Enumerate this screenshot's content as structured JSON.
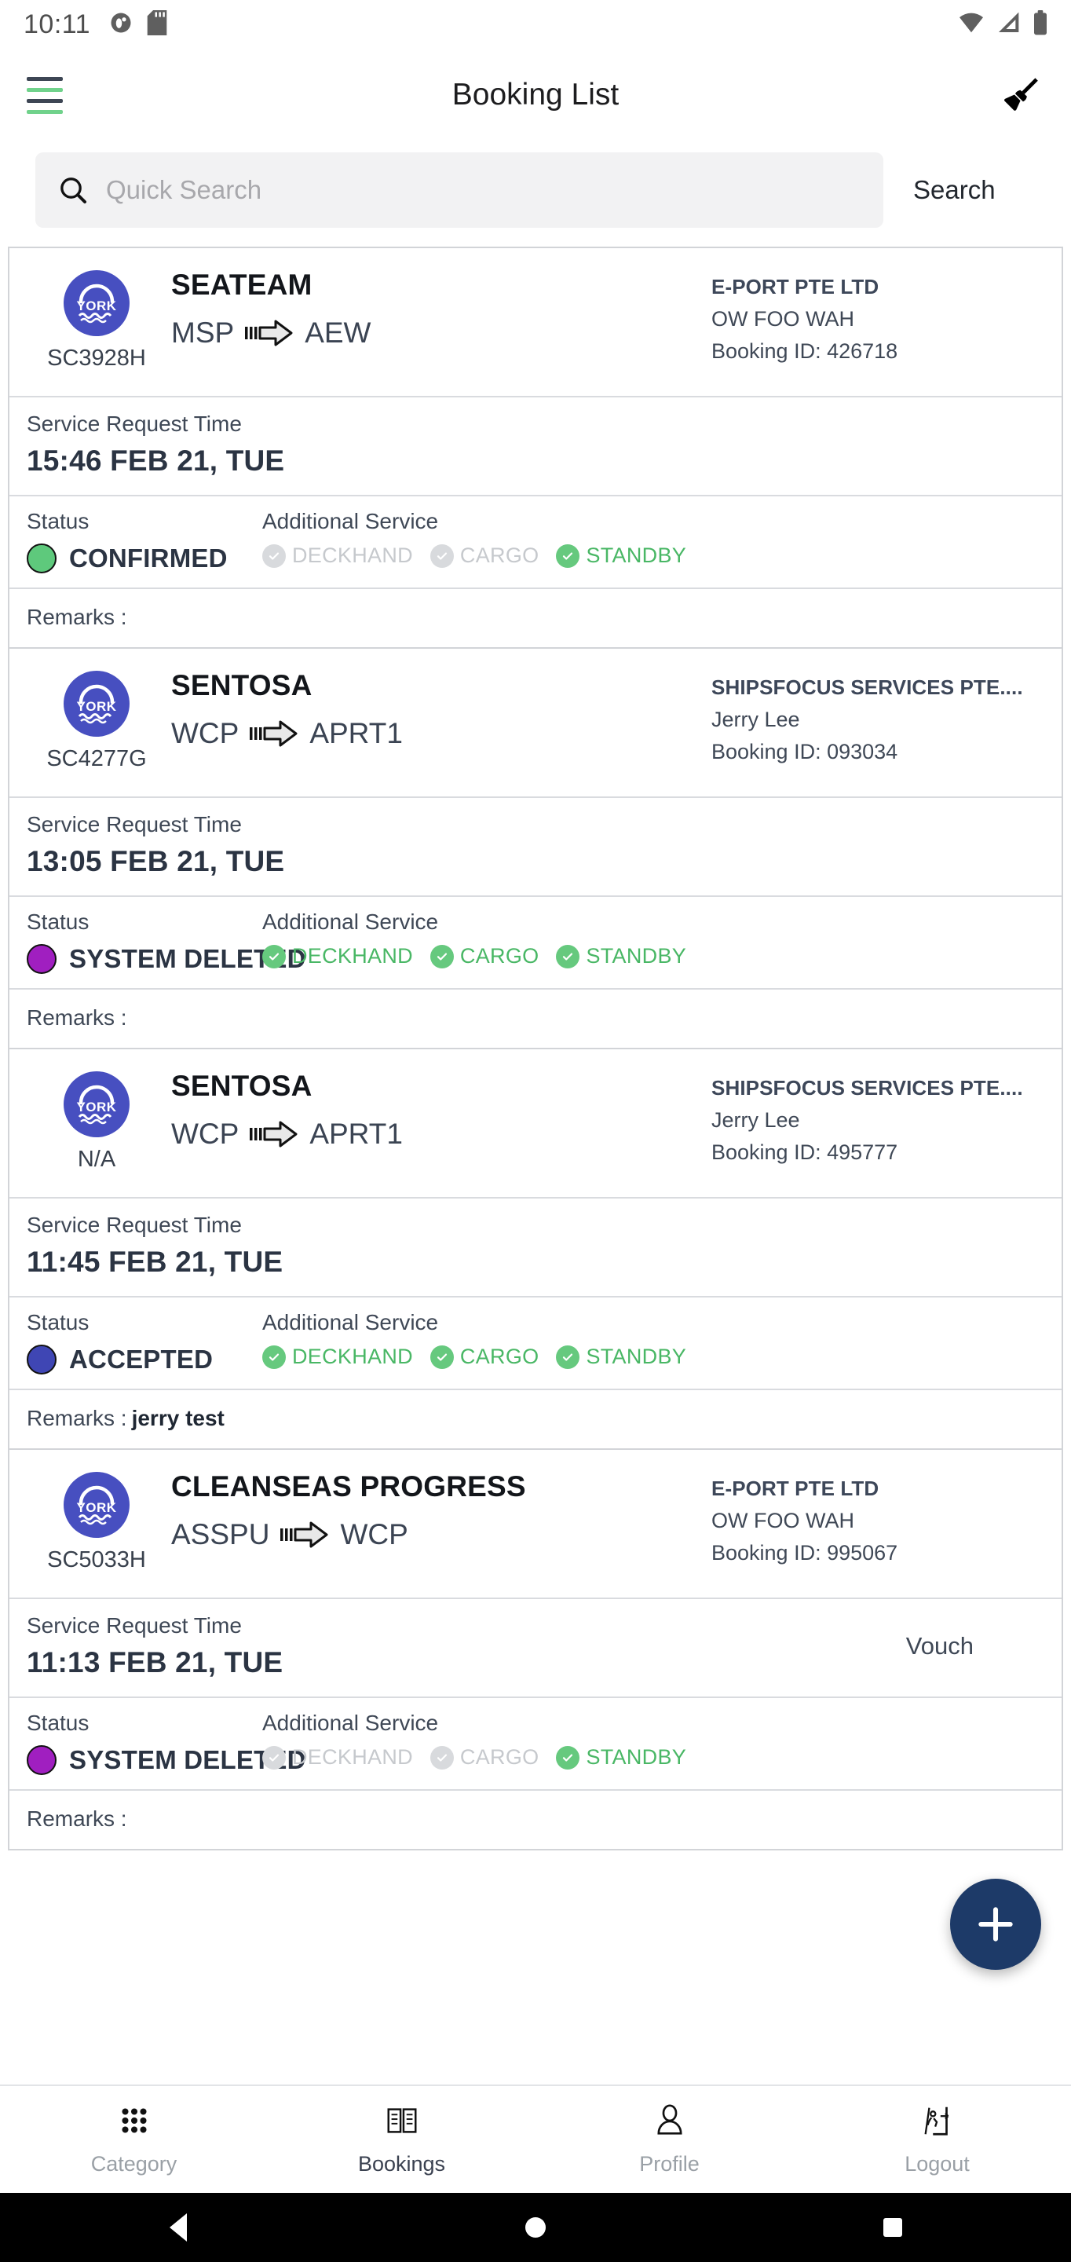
{
  "statusbar": {
    "time": "10:11",
    "left_icons": [
      "app-notification-icon",
      "sd-card-icon"
    ],
    "right_icons": [
      "wifi-icon",
      "cellular-signal-icon",
      "battery-icon"
    ]
  },
  "appbar": {
    "title": "Booking List",
    "menu_icon": "hamburger-menu-icon",
    "action_icon": "broom-clear-icon"
  },
  "search": {
    "icon": "search-icon",
    "value": "",
    "placeholder": "Quick Search",
    "button_label": "Search"
  },
  "labels": {
    "service_request_time": "Service Request Time",
    "status": "Status",
    "additional_service": "Additional Service",
    "remarks": "Remarks :",
    "logo_text": "YORK"
  },
  "colors": {
    "accent_green": "#70d28b",
    "logo_blue": "#474fc0",
    "fab_navy": "#1d3a68",
    "status_confirmed": "#5ec97c",
    "status_system_deleted": "#a01fc0",
    "status_accepted": "#3f46b4",
    "service_on": "#49b765",
    "service_off": "#c6c9cd"
  },
  "bookings": [
    {
      "vessel_code": "SC3928H",
      "vessel_name": "SEATEAM",
      "from_port": "MSP",
      "to_port": "AEW",
      "company": "E-PORT PTE LTD",
      "contact": "OW FOO WAH",
      "booking_id": "Booking ID: 426718",
      "service_request_time": "15:46 FEB 21, TUE",
      "status_label": "CONFIRMED",
      "status_color": "#5ec97c",
      "services": [
        {
          "name": "DECKHAND",
          "enabled": false
        },
        {
          "name": "CARGO",
          "enabled": false
        },
        {
          "name": "STANDBY",
          "enabled": true
        }
      ],
      "remarks": ""
    },
    {
      "vessel_code": "SC4277G",
      "vessel_name": "SENTOSA",
      "from_port": "WCP",
      "to_port": "APRT1",
      "company": "SHIPSFOCUS SERVICES PTE....",
      "contact": "Jerry Lee",
      "booking_id": "Booking ID: 093034",
      "service_request_time": "13:05 FEB 21, TUE",
      "status_label": "SYSTEM DELETED",
      "status_color": "#a01fc0",
      "services": [
        {
          "name": "DECKHAND",
          "enabled": true
        },
        {
          "name": "CARGO",
          "enabled": true
        },
        {
          "name": "STANDBY",
          "enabled": true
        }
      ],
      "remarks": ""
    },
    {
      "vessel_code": "N/A",
      "vessel_name": "SENTOSA",
      "from_port": "WCP",
      "to_port": "APRT1",
      "company": "SHIPSFOCUS SERVICES PTE....",
      "contact": "Jerry Lee",
      "booking_id": "Booking ID: 495777",
      "service_request_time": "11:45 FEB 21, TUE",
      "status_label": "ACCEPTED",
      "status_color": "#3f46b4",
      "services": [
        {
          "name": "DECKHAND",
          "enabled": true
        },
        {
          "name": "CARGO",
          "enabled": true
        },
        {
          "name": "STANDBY",
          "enabled": true
        }
      ],
      "remarks": "jerry test"
    },
    {
      "vessel_code": "SC5033H",
      "vessel_name": "CLEANSEAS PROGRESS",
      "from_port": "ASSPU",
      "to_port": "WCP",
      "company": "E-PORT PTE LTD",
      "contact": "OW FOO WAH",
      "booking_id": "Booking ID: 995067",
      "service_request_time": "11:13 FEB 21, TUE",
      "voucher_text": "Vouch",
      "status_label": "SYSTEM DELETED",
      "status_color": "#a01fc0",
      "services": [
        {
          "name": "DECKHAND",
          "enabled": false
        },
        {
          "name": "CARGO",
          "enabled": false
        },
        {
          "name": "STANDBY",
          "enabled": true
        }
      ],
      "remarks": ""
    }
  ],
  "fab": {
    "icon": "plus-icon",
    "label": "+"
  },
  "bottomnav": [
    {
      "label": "Category",
      "icon": "grid-apps-icon",
      "active": false
    },
    {
      "label": "Bookings",
      "icon": "book-icon",
      "active": true
    },
    {
      "label": "Profile",
      "icon": "person-icon",
      "active": false
    },
    {
      "label": "Logout",
      "icon": "exit-door-icon",
      "active": false
    }
  ],
  "androidnav": [
    {
      "icon": "back-triangle-icon"
    },
    {
      "icon": "home-circle-icon"
    },
    {
      "icon": "recents-square-icon"
    }
  ]
}
